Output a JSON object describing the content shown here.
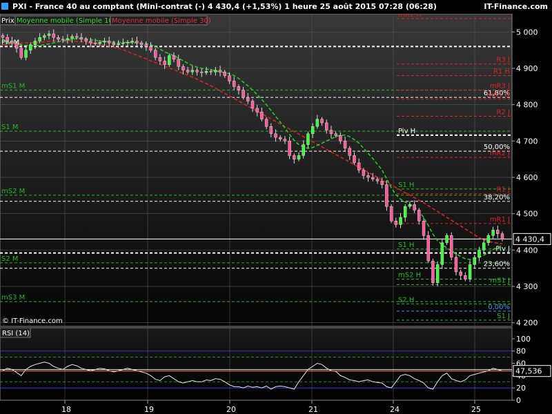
{
  "header": {
    "title": "PXI - France 40 au comptant (Mini-contrat  (-)    4 430,4 (+1,53%)     1 heure  25 août 2015 07:28 (06:28)",
    "brand": "IT-Finance.com"
  },
  "legend": {
    "prix": "Prix",
    "ma10": "Moyenne mobile (Simple 10)",
    "ma30": "Moyenne mobile (Simple 30)"
  },
  "copyright": "© IT-Finance.com",
  "rsi_label": "RSI (14)",
  "colors": {
    "bg_top": "#303030",
    "bg_bottom": "#000000",
    "up": "#33ff33",
    "down": "#ff5599",
    "ma10": "#22cc22",
    "ma30": "#dd2222",
    "green_level": "#22bb22",
    "red_level": "#dd2222"
  },
  "chart_data": [
    {
      "type": "candlestick",
      "ylim": [
        4190,
        5050
      ],
      "y_ticks": [
        "5 000",
        "4 900",
        "4 800",
        "4 700",
        "4 600",
        "4 500",
        "4 400",
        "4 300",
        "4 200"
      ],
      "x_ticks": [
        "18",
        "19",
        "20",
        "21",
        "24",
        "25"
      ],
      "current_price": "4 430,4",
      "close_series": [
        4985,
        4975,
        4970,
        4955,
        4930,
        4950,
        4965,
        4975,
        4985,
        4990,
        4995,
        4985,
        4980,
        4978,
        4982,
        4988,
        4985,
        4980,
        4975,
        4970,
        4968,
        4972,
        4975,
        4970,
        4965,
        4968,
        4970,
        4972,
        4975,
        4970,
        4965,
        4960,
        4950,
        4930,
        4920,
        4910,
        4935,
        4925,
        4905,
        4895,
        4890,
        4895,
        4890,
        4888,
        4892,
        4890,
        4895,
        4890,
        4880,
        4865,
        4850,
        4840,
        4820,
        4810,
        4790,
        4780,
        4760,
        4740,
        4720,
        4710,
        4705,
        4700,
        4660,
        4650,
        4660,
        4690,
        4720,
        4740,
        4760,
        4750,
        4730,
        4720,
        4715,
        4700,
        4680,
        4660,
        4640,
        4620,
        4605,
        4600,
        4595,
        4590,
        4580,
        4520,
        4480,
        4470,
        4490,
        4520,
        4525,
        4510,
        4480,
        4440,
        4370,
        4310,
        4360,
        4420,
        4440,
        4380,
        4340,
        4330,
        4320,
        4360,
        4380,
        4400,
        4420,
        4440,
        4455,
        4445,
        4430
      ],
      "ma10_series": [
        4975,
        4972,
        4970,
        4968,
        4965,
        4963,
        4962,
        4962,
        4963,
        4965,
        4967,
        4970,
        4973,
        4975,
        4978,
        4980,
        4982,
        4982,
        4981,
        4979,
        4977,
        4975,
        4974,
        4973,
        4972,
        4971,
        4971,
        4971,
        4971,
        4970,
        4969,
        4968,
        4965,
        4960,
        4953,
        4945,
        4940,
        4935,
        4928,
        4921,
        4914,
        4908,
        4903,
        4900,
        4898,
        4896,
        4893,
        4890,
        4888,
        4885,
        4880,
        4872,
        4862,
        4852,
        4840,
        4828,
        4814,
        4800,
        4784,
        4768,
        4752,
        4736,
        4718,
        4702,
        4690,
        4683,
        4680,
        4682,
        4688,
        4694,
        4700,
        4706,
        4712,
        4716,
        4716,
        4712,
        4704,
        4694,
        4680,
        4666,
        4652,
        4636,
        4620,
        4596,
        4572,
        4552,
        4540,
        4532,
        4526,
        4518,
        4506,
        4490,
        4468,
        4444,
        4426,
        4414,
        4406,
        4398,
        4390,
        4382,
        4376,
        4374,
        4376,
        4380,
        4386,
        4394,
        4402,
        4408,
        4412
      ],
      "ma30_series": [
        4965,
        4966,
        4967,
        4968,
        4969,
        4970,
        4970,
        4971,
        4972,
        4973,
        4974,
        4975,
        4975,
        4975,
        4975,
        4975,
        4974,
        4973,
        4972,
        4970,
        4968,
        4966,
        4964,
        4961,
        4958,
        4955,
        4951,
        4946,
        4941,
        4936,
        4931,
        4926,
        4921,
        4916,
        4911,
        4906,
        4901,
        4896,
        4891,
        4886,
        4881,
        4876,
        4870,
        4864,
        4858,
        4852,
        4845,
        4838,
        4831,
        4824,
        4817,
        4810,
        4803,
        4796,
        4789,
        4782,
        4775,
        4768,
        4761,
        4754,
        4747,
        4740,
        4733,
        4726,
        4719,
        4712,
        4705,
        4698,
        4691,
        4684,
        4677,
        4670,
        4663,
        4656,
        4649,
        4642,
        4635,
        4628,
        4621,
        4614,
        4607,
        4600,
        4593,
        4586,
        4579,
        4572,
        4565,
        4558,
        4551,
        4544,
        4537,
        4530,
        4522,
        4514,
        4506,
        4498,
        4490,
        4482,
        4474,
        4466,
        4458,
        4450,
        4442,
        4434,
        4428,
        4424,
        4421,
        4419,
        4418
      ],
      "levels": [
        {
          "label": "Piv M",
          "value": 4960,
          "color": "#ffffff",
          "side": "left"
        },
        {
          "label": "mR2 H",
          "value": 5037,
          "color": "#dd2222",
          "side": "right-top"
        },
        {
          "label": "R3 J",
          "value": 4912,
          "color": "#dd2222",
          "side": "right"
        },
        {
          "label": "R1 H",
          "value": 4880,
          "color": "#dd2222",
          "side": "right"
        },
        {
          "label": "mS1 M",
          "value": 4840,
          "color": "#22bb22",
          "side": "left"
        },
        {
          "label": "mR3 J",
          "value": 4840,
          "color": "#dd2222",
          "side": "right"
        },
        {
          "label": "61,80%",
          "value": 4820,
          "color": "#ffffff",
          "side": "right"
        },
        {
          "label": "mR1 H",
          "value": 4815,
          "color": "#dd2222",
          "side": "right"
        },
        {
          "label": "R2 J",
          "value": 4768,
          "color": "#dd2222",
          "side": "right"
        },
        {
          "label": "S1 M",
          "value": 4727,
          "color": "#22bb22",
          "side": "left"
        },
        {
          "label": "Piv H",
          "value": 4716,
          "color": "#ffffff",
          "side": "right-mid"
        },
        {
          "label": "50,00%",
          "value": 4672,
          "color": "#ffffff",
          "side": "right"
        },
        {
          "label": "mR2 J",
          "value": 4655,
          "color": "#dd2222",
          "side": "right"
        },
        {
          "label": "S1 H",
          "value": 4568,
          "color": "#22bb22",
          "side": "right-mid"
        },
        {
          "label": "mS2 M",
          "value": 4551,
          "color": "#22bb22",
          "side": "left"
        },
        {
          "label": "R1 J",
          "value": 4555,
          "color": "#dd2222",
          "side": "right"
        },
        {
          "label": "38,20%",
          "value": 4534,
          "color": "#ffffff",
          "side": "right"
        },
        {
          "label": "mR1 J",
          "value": 4473,
          "color": "#dd2222",
          "side": "right"
        },
        {
          "label": "Piv J",
          "value": 4392,
          "color": "#ffffff",
          "side": "right"
        },
        {
          "label": "S1 H",
          "value": 4403,
          "color": "#22bb22",
          "side": "right-mid"
        },
        {
          "label": "S2 M",
          "value": 4365,
          "color": "#22bb22",
          "side": "left"
        },
        {
          "label": "23,60%",
          "value": 4350,
          "color": "#ffffff",
          "side": "right"
        },
        {
          "label": "mS2 H",
          "value": 4320,
          "color": "#22bb22",
          "side": "right-mid"
        },
        {
          "label": "mS1 J",
          "value": 4305,
          "color": "#22bb22",
          "side": "right"
        },
        {
          "label": "mS3 M",
          "value": 4258,
          "color": "#22bb22",
          "side": "left"
        },
        {
          "label": "S2 H",
          "value": 4252,
          "color": "#22bb22",
          "side": "right-mid"
        },
        {
          "label": "0,00%",
          "value": 4232,
          "color": "#3399ff",
          "side": "right"
        },
        {
          "label": "S1 J",
          "value": 4207,
          "color": "#22bb22",
          "side": "right"
        }
      ]
    },
    {
      "type": "line",
      "title": "RSI (14)",
      "ylim": [
        0,
        110
      ],
      "y_ticks": [
        "100",
        "80",
        "60",
        "40",
        "20",
        "0"
      ],
      "current_value": "47,536",
      "hlines": [
        80,
        70,
        50,
        30,
        20
      ],
      "values": [
        48,
        52,
        50,
        45,
        40,
        50,
        55,
        58,
        60,
        62,
        60,
        55,
        52,
        50,
        55,
        58,
        56,
        52,
        50,
        48,
        50,
        52,
        51,
        48,
        46,
        48,
        50,
        52,
        50,
        48,
        46,
        44,
        40,
        34,
        32,
        38,
        40,
        35,
        30,
        28,
        30,
        32,
        30,
        30,
        33,
        32,
        35,
        34,
        30,
        25,
        22,
        22,
        20,
        23,
        21,
        22,
        20,
        23,
        18,
        22,
        23,
        22,
        20,
        18,
        30,
        40,
        50,
        55,
        60,
        58,
        52,
        48,
        47,
        40,
        37,
        33,
        32,
        30,
        32,
        33,
        30,
        29,
        28,
        22,
        20,
        30,
        40,
        42,
        40,
        35,
        32,
        28,
        20,
        18,
        30,
        40,
        44,
        35,
        32,
        30,
        33,
        40,
        42,
        44,
        46,
        48,
        52,
        50,
        47.5
      ]
    }
  ]
}
